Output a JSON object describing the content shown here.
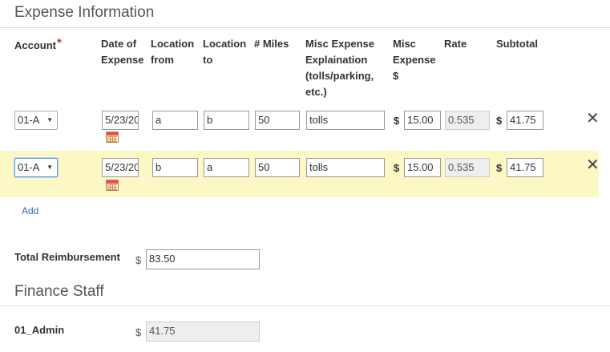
{
  "expense": {
    "section_title": "Expense Information",
    "headers": {
      "account": "Account",
      "account_required": "*",
      "date": "Date of\nExpense",
      "loc_from": "Location\nfrom",
      "loc_to": "Location\nto",
      "miles": "# Miles",
      "misc_explain": "Misc Expense\nExplaination\n(tolls/parking,\netc.)",
      "misc_expense": "Misc\nExpense\n$",
      "rate": "Rate",
      "subtotal": "Subtotal"
    },
    "rows": [
      {
        "account": "01-A",
        "date": "5/23/20",
        "loc_from": "a",
        "loc_to": "b",
        "miles": "50",
        "explanation": "tolls",
        "misc_currency": "$",
        "misc_amount": "15.00",
        "rate": "0.535",
        "subtotal_currency": "$",
        "subtotal": "41.75",
        "highlighted": false
      },
      {
        "account": "01-A",
        "date": "5/23/20",
        "loc_from": "b",
        "loc_to": "a",
        "miles": "50",
        "explanation": "tolls",
        "misc_currency": "$",
        "misc_amount": "15.00",
        "rate": "0.535",
        "subtotal_currency": "$",
        "subtotal": "41.75",
        "highlighted": true
      }
    ],
    "add_link": "Add",
    "highlight_color": "#fbf8c5"
  },
  "total": {
    "label": "Total Reimbursement",
    "currency": "$",
    "value": "83.50"
  },
  "finance": {
    "section_title": "Finance Staff",
    "staff": [
      {
        "name": "01_Admin",
        "currency": "$",
        "value": "41.75"
      }
    ]
  },
  "icons": {
    "remove": "close-icon",
    "date_picker": "calendar-icon",
    "dropdown": "chevron-down-icon"
  }
}
